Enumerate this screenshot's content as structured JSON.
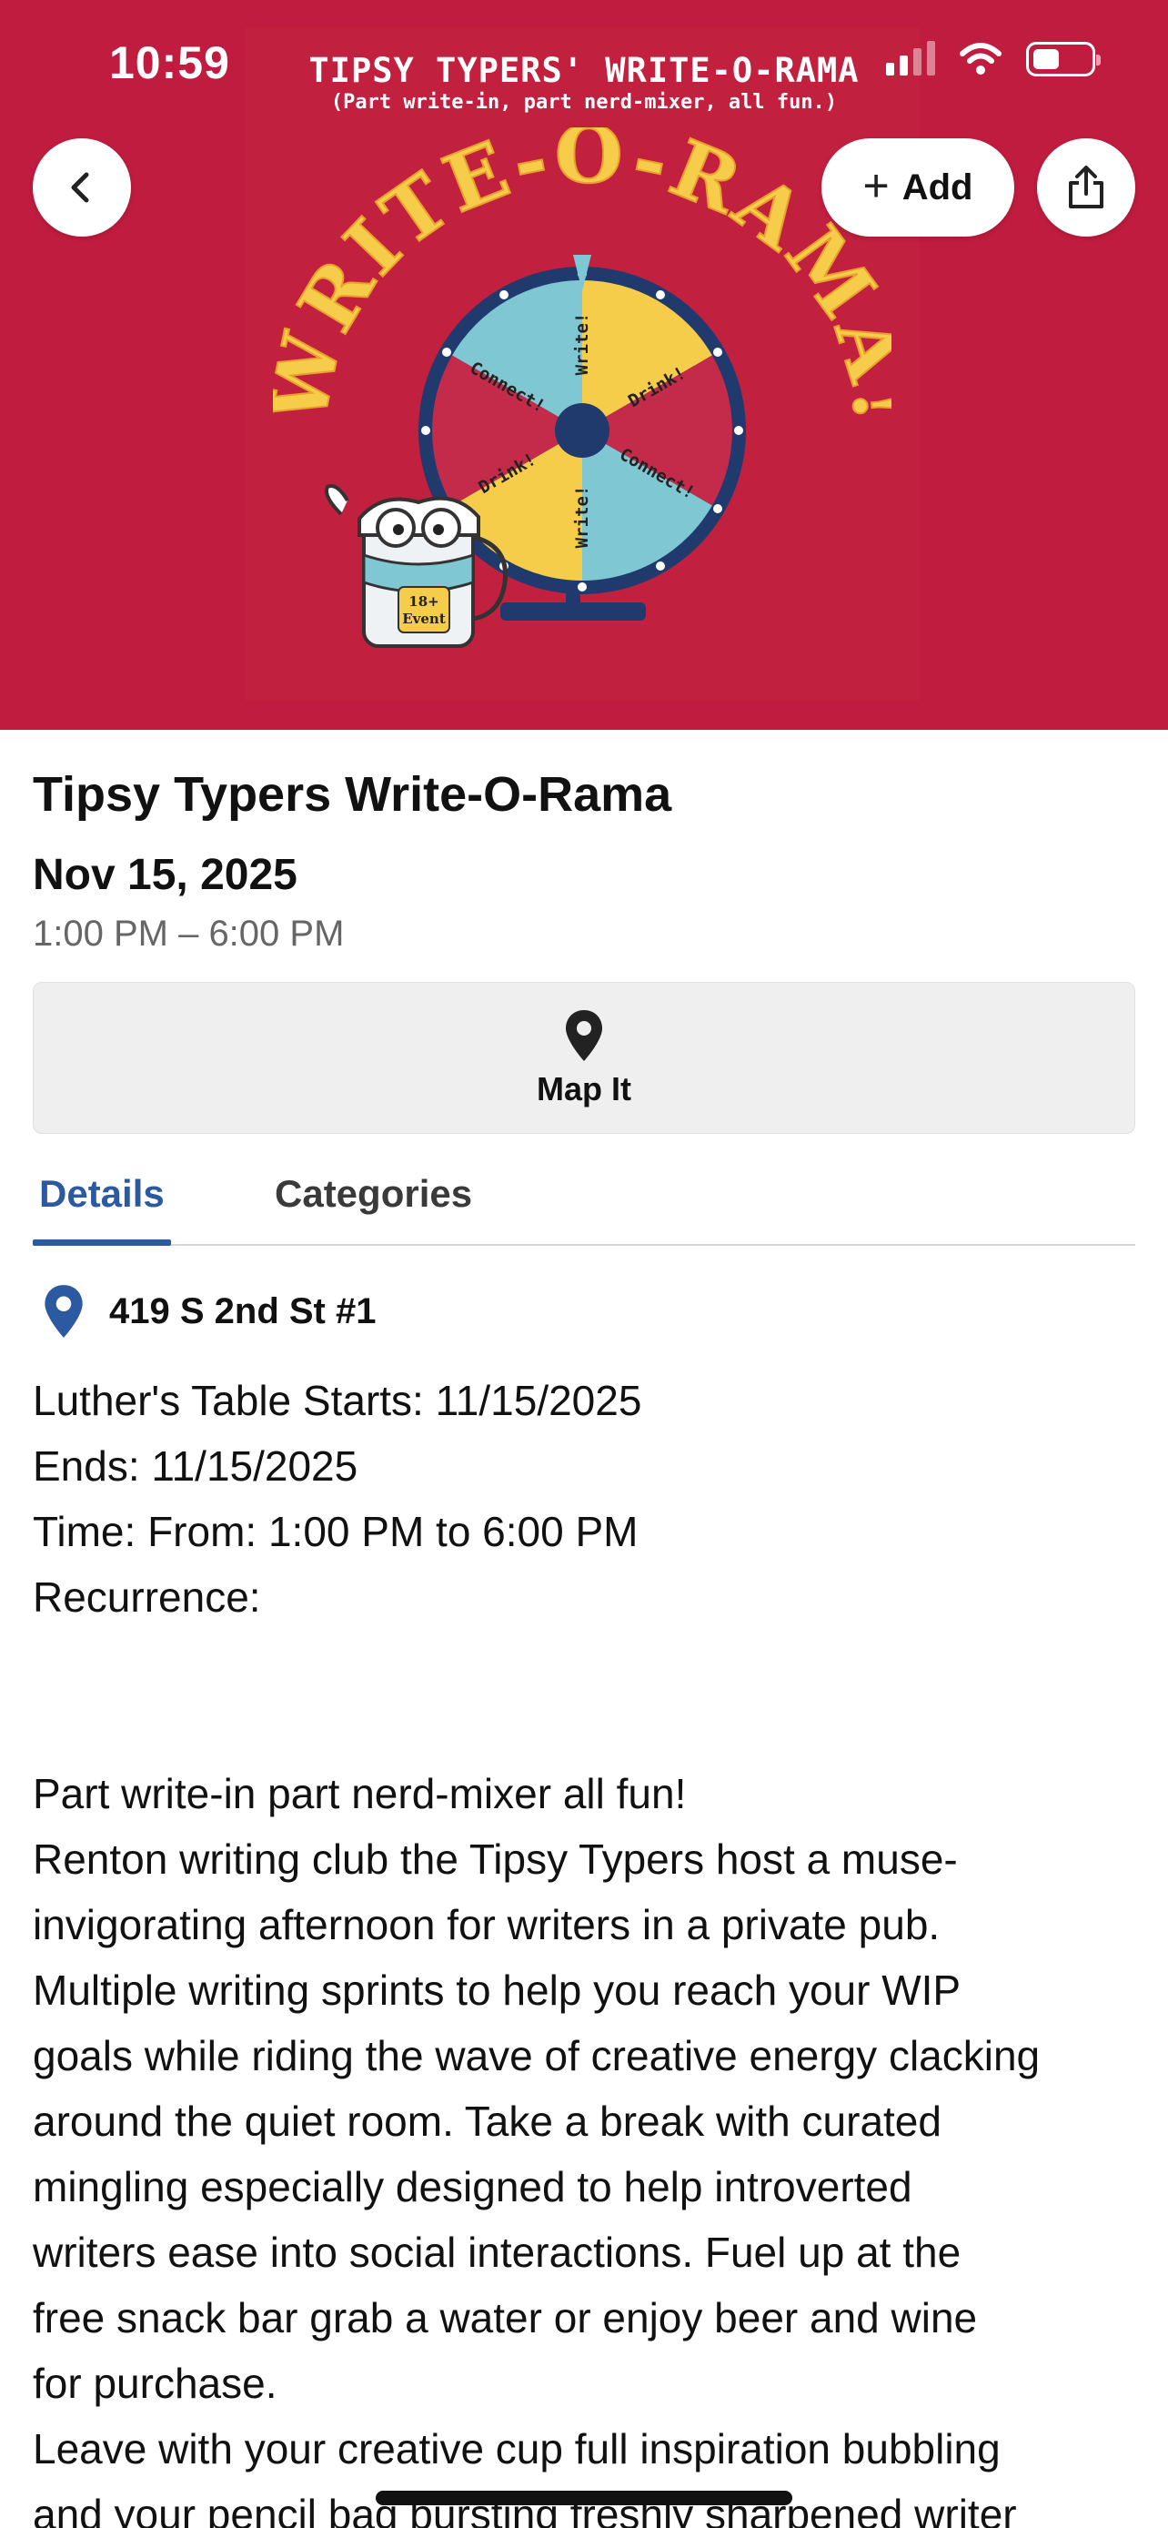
{
  "status_bar": {
    "time": "10:59"
  },
  "hero": {
    "banner_title": "TIPSY TYPERS' WRITE-O-RAMA",
    "banner_subtitle": "(Part write-in, part nerd-mixer, all fun.)",
    "arc_text": "WRITE-O-RAMA!",
    "wheel_segments": [
      "Write!",
      "Drink!",
      "Connect!",
      "Write!",
      "Drink!",
      "Connect!"
    ],
    "mug_badge_line1": "18+",
    "mug_badge_line2": "Event",
    "colors": {
      "background": "#c01c3f",
      "wheel_yellow": "#f5cd4a",
      "wheel_teal": "#7ec7d3",
      "wheel_red": "#c42a4a",
      "wheel_navy": "#203a6e"
    }
  },
  "toolbar": {
    "back_icon": "chevron-left-icon",
    "add_label": "Add",
    "add_icon": "plus-icon",
    "share_icon": "share-icon"
  },
  "event": {
    "title": "Tipsy Typers Write-O-Rama",
    "date": "Nov 15, 2025",
    "time": "1:00 PM – 6:00 PM"
  },
  "map": {
    "label": "Map It",
    "icon": "map-pin-icon"
  },
  "tabs": [
    {
      "label": "Details",
      "active": true
    },
    {
      "label": "Categories",
      "active": false
    }
  ],
  "details": {
    "address": "419 S 2nd St #1",
    "address_icon": "location-pin-icon",
    "info_lines": [
      "Luther's Table Starts: 11/15/2025",
      "Ends: 11/15/2025",
      "Time: From: 1:00 PM to 6:00 PM",
      "Recurrence:"
    ],
    "description_lines": [
      "Part write-in part nerd-mixer all fun!",
      "Renton writing club the Tipsy Typers host a muse-",
      "invigorating afternoon for writers in a private pub.",
      "Multiple writing sprints to help you reach your WIP",
      "goals while riding the wave of creative energy clacking",
      "around the quiet room. Take a break with curated",
      "mingling especially designed to help introverted",
      "writers ease into social interactions. Fuel up at the",
      "free snack bar grab a water or enjoy beer and wine",
      "for purchase.",
      "Leave with your creative cup full inspiration bubbling",
      "and your pencil bag bursting freshly sharpened writer"
    ]
  },
  "accent_color": "#2c5aa0"
}
